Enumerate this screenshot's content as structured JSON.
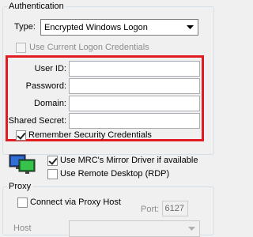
{
  "authentication": {
    "title": "Authentication",
    "type_label": "Type:",
    "type_value": "Encrypted Windows Logon",
    "use_current_logon_label": "Use Current Logon Credentials",
    "user_id_label": "User ID:",
    "user_id_value": "",
    "password_label": "Password:",
    "password_value": "",
    "domain_label": "Domain:",
    "domain_value": "",
    "shared_secret_label": "Shared Secret:",
    "shared_secret_value": "",
    "remember_label": "Remember Security Credentials",
    "remember_checked": true
  },
  "display": {
    "mirror_driver_label": "Use MRC's Mirror Driver if available",
    "mirror_driver_checked": true,
    "remote_desktop_label": "Use Remote Desktop (RDP)",
    "remote_desktop_checked": false
  },
  "proxy": {
    "title": "Proxy",
    "connect_label": "Connect via Proxy Host",
    "connect_checked": false,
    "port_label": "Port:",
    "port_value": "6127",
    "host_label": "Host",
    "host_value": ""
  },
  "colors": {
    "highlight_border": "#e01b22"
  },
  "icons": {
    "display": "dual-monitor-icon"
  }
}
